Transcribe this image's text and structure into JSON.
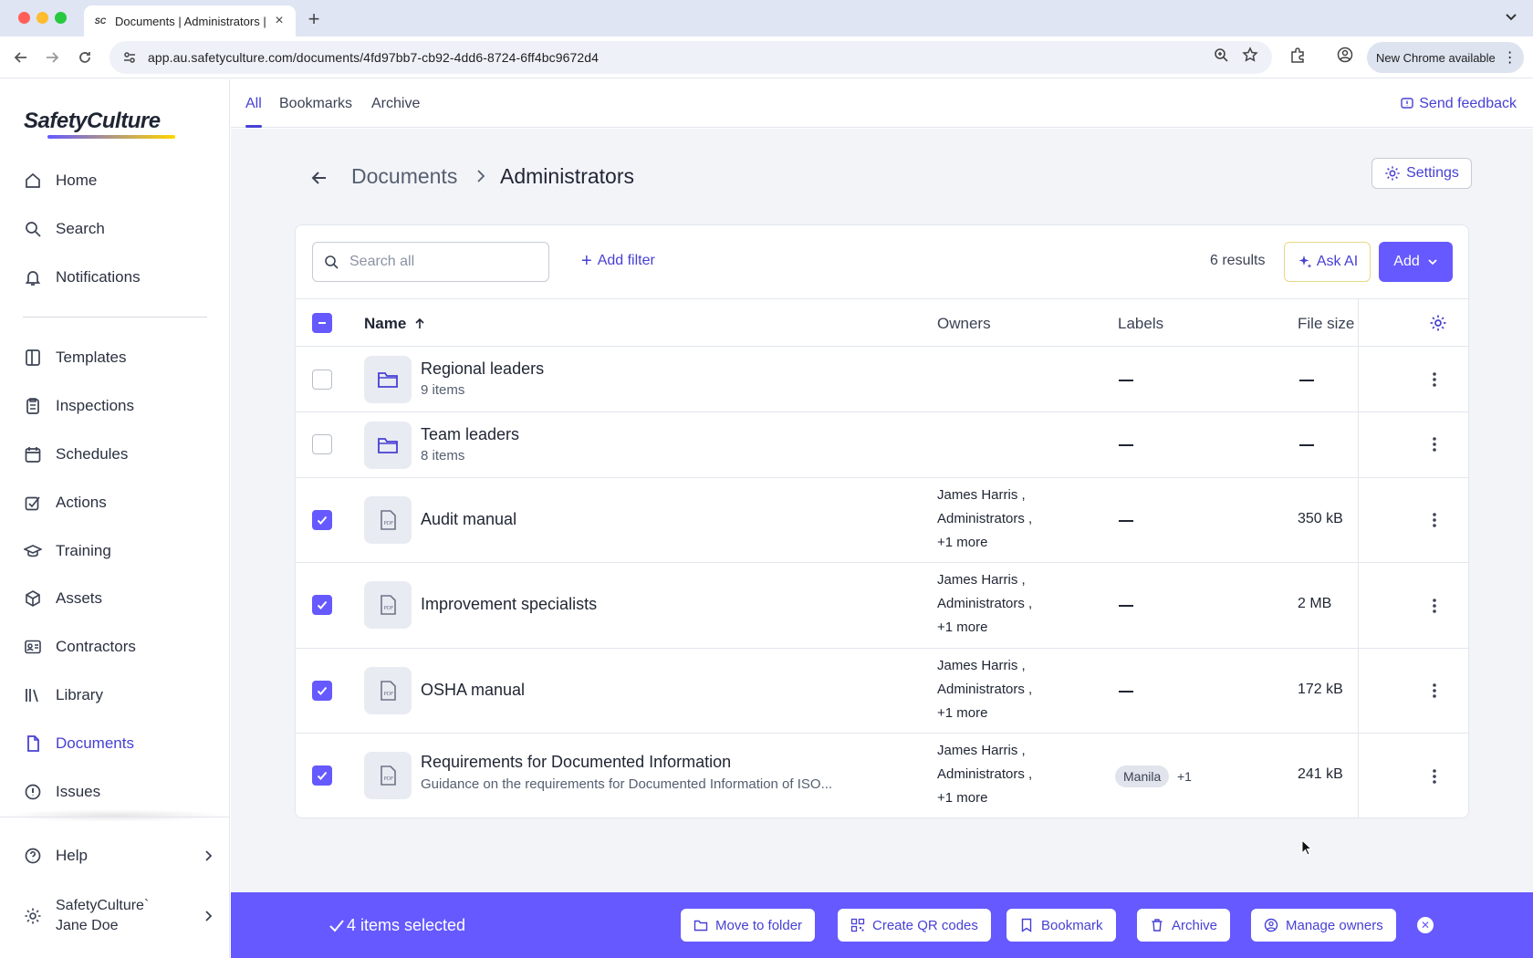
{
  "browser": {
    "tab_title": "Documents | Administrators |",
    "favicon_text": "SC",
    "url": "app.au.safetyculture.com/documents/4fd97bb7-cb92-4dd6-8724-6ff4bc9672d4",
    "new_chrome_label": "New Chrome available"
  },
  "sidebar": {
    "logo": "SafetyCulture",
    "items": [
      {
        "label": "Home",
        "icon": "home-icon"
      },
      {
        "label": "Search",
        "icon": "search-icon"
      },
      {
        "label": "Notifications",
        "icon": "bell-icon"
      },
      {
        "label": "Templates",
        "icon": "template-icon"
      },
      {
        "label": "Inspections",
        "icon": "clipboard-icon"
      },
      {
        "label": "Schedules",
        "icon": "calendar-icon"
      },
      {
        "label": "Actions",
        "icon": "action-check-icon"
      },
      {
        "label": "Training",
        "icon": "graduation-cap-icon"
      },
      {
        "label": "Assets",
        "icon": "cube-icon"
      },
      {
        "label": "Contractors",
        "icon": "id-card-icon"
      },
      {
        "label": "Library",
        "icon": "books-icon"
      },
      {
        "label": "Documents",
        "icon": "document-icon"
      },
      {
        "label": "Issues",
        "icon": "alert-icon"
      }
    ],
    "active": "Documents",
    "help_label": "Help",
    "org_name": "SafetyCulture`",
    "user_name": "Jane Doe"
  },
  "top_tabs": {
    "all": "All",
    "bookmarks": "Bookmarks",
    "archive": "Archive",
    "active": "All",
    "feedback": "Send feedback"
  },
  "breadcrumb": {
    "parent": "Documents",
    "current": "Administrators"
  },
  "settings_label": "Settings",
  "toolbar": {
    "search_placeholder": "Search all",
    "add_filter": "Add filter",
    "results": "6 results",
    "ask_ai": "Ask AI",
    "add": "Add"
  },
  "table": {
    "columns": {
      "name": "Name",
      "owners": "Owners",
      "labels": "Labels",
      "file_size": "File size"
    },
    "rows": [
      {
        "name": "Regional leaders",
        "sub": "9 items",
        "type": "folder",
        "checked": false,
        "owners": [],
        "labels": "—",
        "size": "—"
      },
      {
        "name": "Team leaders",
        "sub": "8 items",
        "type": "folder",
        "checked": false,
        "owners": [],
        "labels": "—",
        "size": "—"
      },
      {
        "name": "Audit manual",
        "sub": "",
        "type": "pdf",
        "checked": true,
        "owners": [
          "James Harris ,",
          "Administrators ,",
          "+1 more"
        ],
        "labels": "—",
        "size": "350 kB"
      },
      {
        "name": "Improvement specialists",
        "sub": "",
        "type": "pdf",
        "checked": true,
        "owners": [
          "James Harris ,",
          "Administrators ,",
          "+1 more"
        ],
        "labels": "—",
        "size": "2 MB"
      },
      {
        "name": "OSHA manual",
        "sub": "",
        "type": "pdf",
        "checked": true,
        "owners": [
          "James Harris ,",
          "Administrators ,",
          "+1 more"
        ],
        "labels": "—",
        "size": "172 kB"
      },
      {
        "name": "Requirements for Documented Information",
        "sub": "Guidance on the requirements for Documented Information of ISO...",
        "type": "pdf",
        "checked": true,
        "owners": [
          "James Harris ,",
          "Administrators ,",
          "+1 more"
        ],
        "label_chip": "Manila",
        "label_more": "+1",
        "size": "241 kB"
      }
    ]
  },
  "selection_bar": {
    "count_text": "4 items selected",
    "move": "Move to folder",
    "qr": "Create QR codes",
    "bookmark": "Bookmark",
    "archive": "Archive",
    "owners": "Manage owners"
  },
  "colors": {
    "accent": "#6559ff",
    "accent_text": "#4740d4",
    "background": "#f3f4f8"
  }
}
